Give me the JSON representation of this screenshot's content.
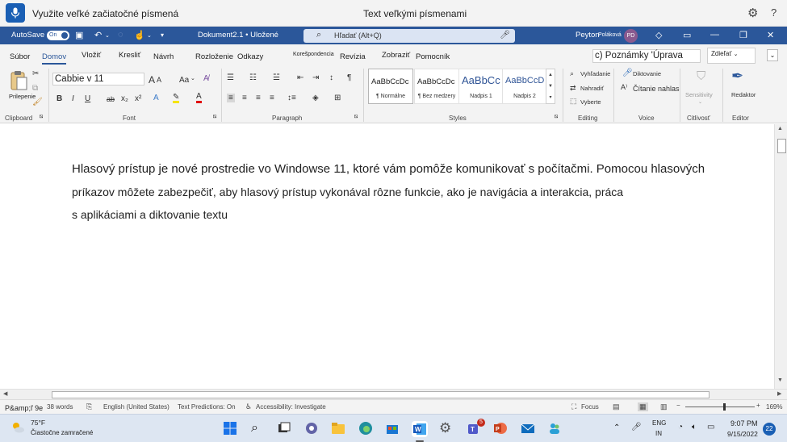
{
  "voice_access": {
    "hint": "Využite veľké začiatočné písmená",
    "command": "Text veľkými písmenami",
    "settings_icon": "gear-icon",
    "help_label": "?"
  },
  "titlebar": {
    "autosave_label": "AutoSave",
    "autosave_state": "On",
    "doc_title": "Dokument2.1 • Uložené",
    "search_placeholder": "Hľadať (Alt+Q)",
    "user_name": "Peyton",
    "user_surname": "Poláková",
    "user_initials": "PD"
  },
  "ribbon": {
    "tabs": [
      "Súbor",
      "Domov",
      "Vložiť",
      "Kresliť",
      "Návrh",
      "Rozloženie",
      "Odkazy",
      "Korešpondencia",
      "Revízia",
      "Zobraziť",
      "Pomocník"
    ],
    "notes_box": "c) Poznámky 'Úprava",
    "share_label": "Zdieľať",
    "clipboard": {
      "paste_label": "Prilepenie",
      "group_label": "Clipboard"
    },
    "font": {
      "name": "Cabbie v 11",
      "group_label": "Font",
      "grow": "A",
      "shrink": "A",
      "case": "Aa",
      "bold": "B",
      "italic": "I",
      "underline": "U",
      "strike": "ab",
      "subscript": "x₂",
      "superscript": "x²"
    },
    "paragraph": {
      "group_label": "Paragraph",
      "pilcrow": "¶"
    },
    "styles": {
      "group_label": "Styles",
      "items": [
        {
          "preview": "AaBbCcDc",
          "name": "¶ Normálne"
        },
        {
          "preview": "AaBbCcDc",
          "name": "¶ Bez medzery"
        },
        {
          "preview": "AaBbCc",
          "name": "Nadpis 1"
        },
        {
          "preview": "AaBbCcD",
          "name": "Nadpis 2"
        }
      ]
    },
    "editing": {
      "group_label": "Editing",
      "find": "Vyhľadanie",
      "replace": "Nahradiť",
      "select": "Vyberte"
    },
    "voice": {
      "group_label": "Voice",
      "dictate": "Diktovanie",
      "read_aloud": "Čítanie nahlas"
    },
    "sensitivity": {
      "group_label": "Citlivosť",
      "label": "Sensitivity"
    },
    "editor": {
      "group_label": "Editor",
      "label": "Redaktor"
    }
  },
  "document": {
    "lines": [
      "Hlasový prístup je nové prostredie vo Windowse 11, ktoré vám pomôže komunikovať s počítačmi. Pomocou hlasových",
      "príkazov môžete zabezpečiť, aby hlasový prístup vykonával rôzne funkcie, ako je navigácia a interakcia, práca",
      "s aplikáciami a diktovanie textu"
    ]
  },
  "statusbar": {
    "page_label": "P&amp;ľ 9e",
    "words": "38 words",
    "language": "English (United States)",
    "text_predictions": "Text Predictions: On",
    "accessibility": "Accessibility: Investigate",
    "focus": "Focus",
    "zoom": "169%",
    "zoom_fraction": 0.56
  },
  "taskbar": {
    "weather_temp": "75°F",
    "weather_desc": "Čiastočne zamračené",
    "teams_badge": "5",
    "lang_1": "ENG",
    "lang_2": "IN",
    "time": "9:07 PM",
    "date": "9/15/2022",
    "notifications": "22"
  },
  "colors": {
    "word_blue": "#2b579a",
    "voice_blue": "#1a5fb4",
    "taskbar_bg": "#dde6f2"
  }
}
